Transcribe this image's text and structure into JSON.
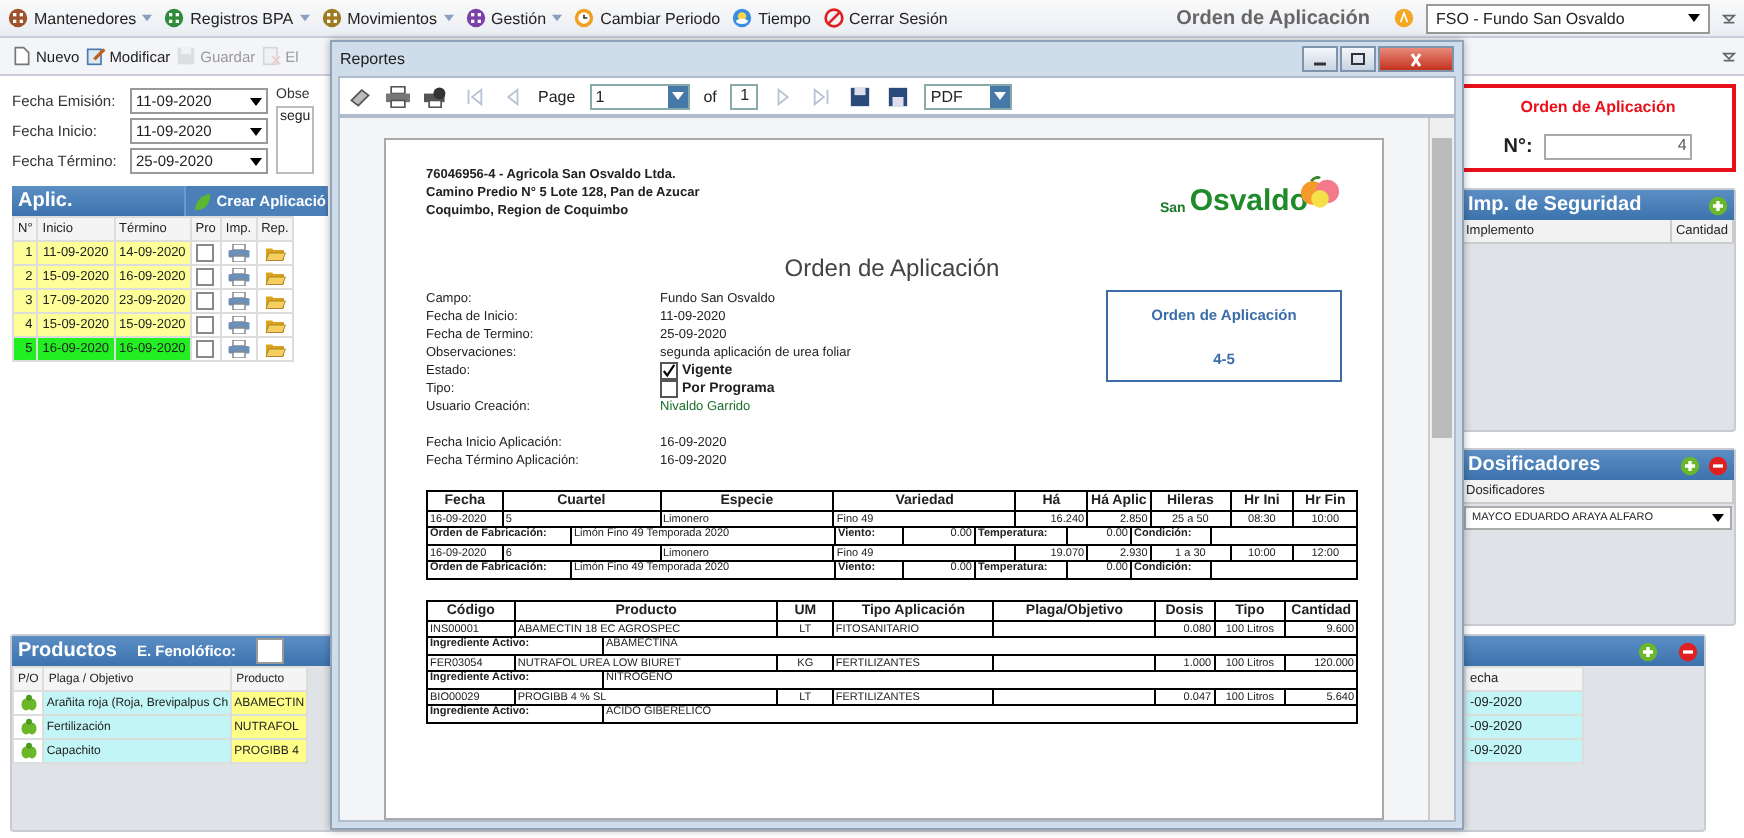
{
  "menu": [
    {
      "label": "Mantenedores",
      "kind": "dropdown",
      "color": "#a0522d"
    },
    {
      "label": "Registros BPA",
      "kind": "dropdown",
      "color": "#2e8b3a"
    },
    {
      "label": "Movimientos",
      "kind": "dropdown",
      "color": "#a07a20"
    },
    {
      "label": "Gestión",
      "kind": "dropdown",
      "color": "#7b3fa8"
    },
    {
      "label": "Cambiar Periodo",
      "kind": "clock",
      "color": "#f0a020"
    },
    {
      "label": "Tiempo",
      "kind": "weather",
      "color": "#3a8ee0"
    },
    {
      "label": "Cerrar Sesión",
      "kind": "stop",
      "color": "#e02020"
    }
  ],
  "page_title": "Orden de Aplicación",
  "fundo_select": {
    "value": "FSO - Fundo San Osvaldo"
  },
  "toolbar": [
    {
      "label": "Nuevo",
      "kind": "new",
      "disabled": false
    },
    {
      "label": "Modificar",
      "kind": "edit",
      "disabled": false
    },
    {
      "label": "Guardar",
      "kind": "save",
      "disabled": true
    },
    {
      "label": "El",
      "kind": "delete",
      "disabled": true
    }
  ],
  "form": {
    "fields": [
      {
        "label": "Fecha Emisión:",
        "value": "11-09-2020"
      },
      {
        "label": "Fecha Inicio:",
        "value": "11-09-2020"
      },
      {
        "label": "Fecha Término:",
        "value": "25-09-2020"
      }
    ],
    "observaciones": {
      "label": "Obse",
      "value": "segu"
    }
  },
  "aplic": {
    "title": "Aplic.",
    "create_button": "Crear Aplicació",
    "columns": [
      "N°",
      "Inicio",
      "Término",
      "Pro",
      "Imp.",
      "Rep."
    ],
    "rows": [
      {
        "n": "1",
        "inicio": "11-09-2020",
        "termino": "14-09-2020",
        "color": "#ffff99",
        "checked": false
      },
      {
        "n": "2",
        "inicio": "15-09-2020",
        "termino": "16-09-2020",
        "color": "#ffff99",
        "checked": false
      },
      {
        "n": "3",
        "inicio": "17-09-2020",
        "termino": "23-09-2020",
        "color": "#ffff99",
        "checked": false
      },
      {
        "n": "4",
        "inicio": "15-09-2020",
        "termino": "15-09-2020",
        "color": "#ffff99",
        "checked": false
      },
      {
        "n": "5",
        "inicio": "16-09-2020",
        "termino": "16-09-2020",
        "color": "#22ee22",
        "checked": false
      }
    ]
  },
  "order_box": {
    "title": "Orden de Aplicación",
    "label": "N°:",
    "value": "4"
  },
  "seguridad": {
    "title": "Imp. de Seguridad",
    "columns": [
      "Implemento",
      "Cantidad"
    ]
  },
  "dosificadores": {
    "title": "Dosificadores",
    "column": "Dosificadores",
    "value": "MAYCO EDUARDO ARAYA ALFARO"
  },
  "productos": {
    "title": "Productos",
    "fenologico_label": "E. Fenolófico:",
    "columns": [
      "P/O",
      "Plaga / Objetivo",
      "Producto"
    ],
    "rows": [
      {
        "plaga": "Arañita roja (Roja, Brevipalpus Ch",
        "producto": "ABAMECTIN"
      },
      {
        "plaga": "Fertilización",
        "producto": "NUTRAFOL"
      },
      {
        "plaga": "Capachito",
        "producto": "PROGIBB 4"
      }
    ],
    "right_column": "echa",
    "right_values": [
      "-09-2020",
      "-09-2020",
      "-09-2020"
    ]
  },
  "modal": {
    "title": "Reportes",
    "page_label": "Page",
    "page": "1",
    "of_label": "of",
    "total": "1",
    "format": "PDF"
  },
  "report": {
    "company": [
      "76046956-4 - Agricola San Osvaldo Ltda.",
      "Camino Predio N° 5 Lote 128, Pan de Azucar",
      "Coquimbo, Region de Coquimbo"
    ],
    "logo": {
      "small": "San",
      "big": "Osvaldo"
    },
    "title": "Orden de Aplicación",
    "fields": [
      {
        "label": "Campo:",
        "value": "Fundo San Osvaldo",
        "kind": "text"
      },
      {
        "label": "Fecha de Inicio:",
        "value": "11-09-2020",
        "kind": "text"
      },
      {
        "label": "Fecha de Termino:",
        "value": "25-09-2020",
        "kind": "text"
      },
      {
        "label": "Observaciones:",
        "value": "segunda aplicación de urea foliar",
        "kind": "text"
      },
      {
        "label": "Estado:",
        "value": "Vigente",
        "kind": "check",
        "checked": true
      },
      {
        "label": "Tipo:",
        "value": "Por Programa",
        "kind": "check",
        "checked": false
      },
      {
        "label": "Usuario Creación:",
        "value": "Nivaldo Garrido",
        "kind": "text"
      },
      {
        "label": "Fecha Inicio Aplicación:",
        "value": "16-09-2020",
        "kind": "gap"
      },
      {
        "label": "Fecha Término Aplicación:",
        "value": "16-09-2020",
        "kind": "text"
      }
    ],
    "box": {
      "title": "Orden de Aplicación",
      "number": "4-5"
    },
    "schedule": {
      "columns": [
        "Fecha",
        "Cuartel",
        "Especie",
        "Variedad",
        "Há",
        "Há Aplic",
        "Hileras",
        "Hr Ini",
        "Hr Fin"
      ],
      "rows": [
        {
          "kind": "main",
          "cells": [
            "16-09-2020",
            "5",
            "Limonero",
            "Fino 49",
            "16.240",
            "2.850",
            "25 a 50",
            "08:30",
            "10:00"
          ]
        },
        {
          "kind": "detail",
          "orden": {
            "label": "Orden de Fabricación:",
            "value": "Limón Fino 49 Temporada 2020"
          },
          "viento": {
            "label": "Viento:",
            "value": "0.00"
          },
          "temperatura": {
            "label": "Temperatura:",
            "value": "0.00"
          },
          "condicion": {
            "label": "Condición:"
          }
        },
        {
          "kind": "main",
          "cells": [
            "16-09-2020",
            "6",
            "Limonero",
            "Fino 49",
            "19.070",
            "2.930",
            "1 a 30",
            "10:00",
            "12:00"
          ]
        },
        {
          "kind": "detail",
          "orden": {
            "label": "Orden de Fabricación:",
            "value": "Limón Fino 49 Temporada 2020"
          },
          "viento": {
            "label": "Viento:",
            "value": "0.00"
          },
          "temperatura": {
            "label": "Temperatura:",
            "value": "0.00"
          },
          "condicion": {
            "label": "Condición:"
          }
        }
      ]
    },
    "products": {
      "columns": [
        "Código",
        "Producto",
        "UM",
        "Tipo Aplicación",
        "Plaga/Objetivo",
        "Dosis",
        "Tipo",
        "Cantidad"
      ],
      "rows": [
        {
          "kind": "main",
          "cells": [
            "INS00001",
            "ABAMECTIN 18 EC AGROSPEC",
            "LT",
            "FITOSANITARIO",
            "",
            "0.080",
            "100 Litros",
            "9.600"
          ]
        },
        {
          "kind": "detail",
          "ingrediente": {
            "label": "Ingrediente Activo:",
            "value": "ABAMECTINA"
          }
        },
        {
          "kind": "main",
          "cells": [
            "FER03054",
            "NUTRAFOL UREA LOW BIURET",
            "KG",
            "FERTILIZANTES",
            "",
            "1.000",
            "100 Litros",
            "120.000"
          ]
        },
        {
          "kind": "detail",
          "ingrediente": {
            "label": "Ingrediente Activo:",
            "value": "NITROGENO"
          }
        },
        {
          "kind": "main",
          "cells": [
            "BIO00029",
            "PROGIBB 4 % SL",
            "LT",
            "FERTILIZANTES",
            "",
            "0.047",
            "100 Litros",
            "5.640"
          ]
        },
        {
          "kind": "detail",
          "ingrediente": {
            "label": "Ingrediente Activo:",
            "value": "ACIDO GIBERELICO"
          }
        }
      ]
    }
  }
}
